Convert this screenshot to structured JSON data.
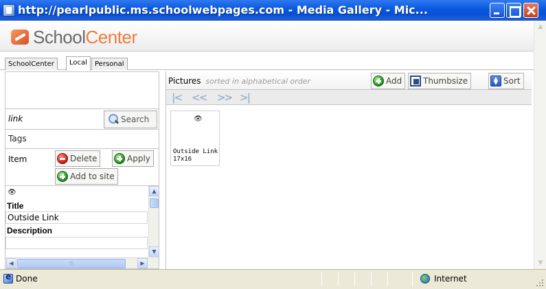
{
  "window": {
    "title": "http://pearlpublic.ms.schoolwebpages.com - Media Gallery - Mic...",
    "icon": "ie-window-icon",
    "buttons": [
      "minimize",
      "maximize",
      "close"
    ]
  },
  "logo": {
    "part1": "School",
    "part2": "Center",
    "color_main": "#6a6a6a",
    "color_accent": "#ec7d3d"
  },
  "tabs": [
    {
      "label": "SchoolCenter",
      "active": false
    },
    {
      "label": "Local",
      "active": true
    },
    {
      "label": "Personal",
      "active": false
    }
  ],
  "sidebar": {
    "search": {
      "value": "link",
      "button_label": "Search"
    },
    "tags_label": "Tags",
    "item": {
      "label": "Item",
      "delete_label": "Delete",
      "apply_label": "Apply",
      "add_to_site_label": "Add to site"
    },
    "detail": {
      "eye_glyph": "👁",
      "title_label": "Title",
      "title_value": "Outside Link",
      "description_label": "Description",
      "description_value": ""
    }
  },
  "gallery": {
    "title": "Pictures",
    "subtitle": "sorted in alphabetical order",
    "add_label": "Add",
    "thumbsize_label": "Thumbsize",
    "sort_label": "Sort",
    "pager": {
      "first": "|<",
      "prev": "<<",
      "next": ">>",
      "last": ">|"
    },
    "items": [
      {
        "eye_glyph": "👁",
        "name": "Outside Link",
        "size": "17x16"
      }
    ]
  },
  "statusbar": {
    "status": "Done",
    "zone": "Internet"
  }
}
